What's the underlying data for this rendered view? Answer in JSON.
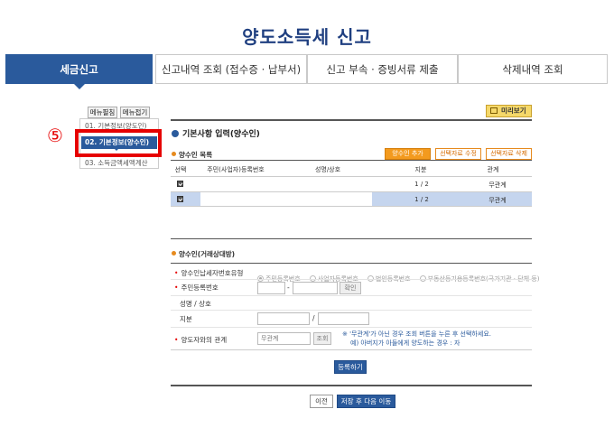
{
  "page_title": "양도소득세 신고",
  "tabs": [
    {
      "label": "세금신고"
    },
    {
      "label": "신고내역 조회 (접수증 · 납부서)"
    },
    {
      "label": "신고 부속 · 증빙서류 제출"
    },
    {
      "label": "삭제내역 조회"
    }
  ],
  "side": {
    "expand_label": "메뉴펼침",
    "collapse_label": "메뉴접기",
    "items": [
      {
        "label": "01. 기본정보(양도인)"
      },
      {
        "label": "02. 기본정보(양수인)"
      },
      {
        "label": "03. 소득금액세액계산"
      }
    ]
  },
  "annotation": {
    "step": "⑤"
  },
  "preview_label": "미리보기",
  "section": {
    "title": "기본사항 입력(양수인)",
    "list_title": "양수인 목록",
    "buttons": {
      "add": "양수인 추가",
      "edit": "선택자료 수정",
      "delete": "선택자료 삭제"
    }
  },
  "table": {
    "headers": [
      "선택",
      "주민(사업자)등록번호",
      "성명/상호",
      "지분",
      "관계"
    ],
    "rows": [
      {
        "checked": true,
        "reg_no": "",
        "name": "",
        "share": "1 / 2",
        "relation": "무관계",
        "selected": false
      },
      {
        "checked": true,
        "reg_no": "",
        "name": "",
        "share": "1 / 2",
        "relation": "무관계",
        "selected": true
      }
    ]
  },
  "form": {
    "title": "양수인(거래상대방)",
    "type_label": "양수인납세자번호유형",
    "type_options": [
      "주민등록번호",
      "사업자등록번호",
      "법인등록번호",
      "부동산등기용등록번호(국가기관 · 단체 등)"
    ],
    "regno_label": "주민등록번호",
    "regno_sep": "-",
    "confirm_label": "확인",
    "name_label": "성명 / 상호",
    "share_label": "지분",
    "share_sep": "/",
    "relation_label": "양도자와의 관계",
    "relation_value": "무관계",
    "lookup_label": "조회",
    "note_line1": "※ '무관계'가 아닌 경우 조회 버튼을 누른 후 선택하세요.",
    "note_line2": "예) 아버지가 아들에게 양도하는 경우 : 자",
    "submit_label": "등록하기"
  },
  "footer": {
    "prev_label": "이전",
    "next_label": "저장 후 다음 이동"
  }
}
